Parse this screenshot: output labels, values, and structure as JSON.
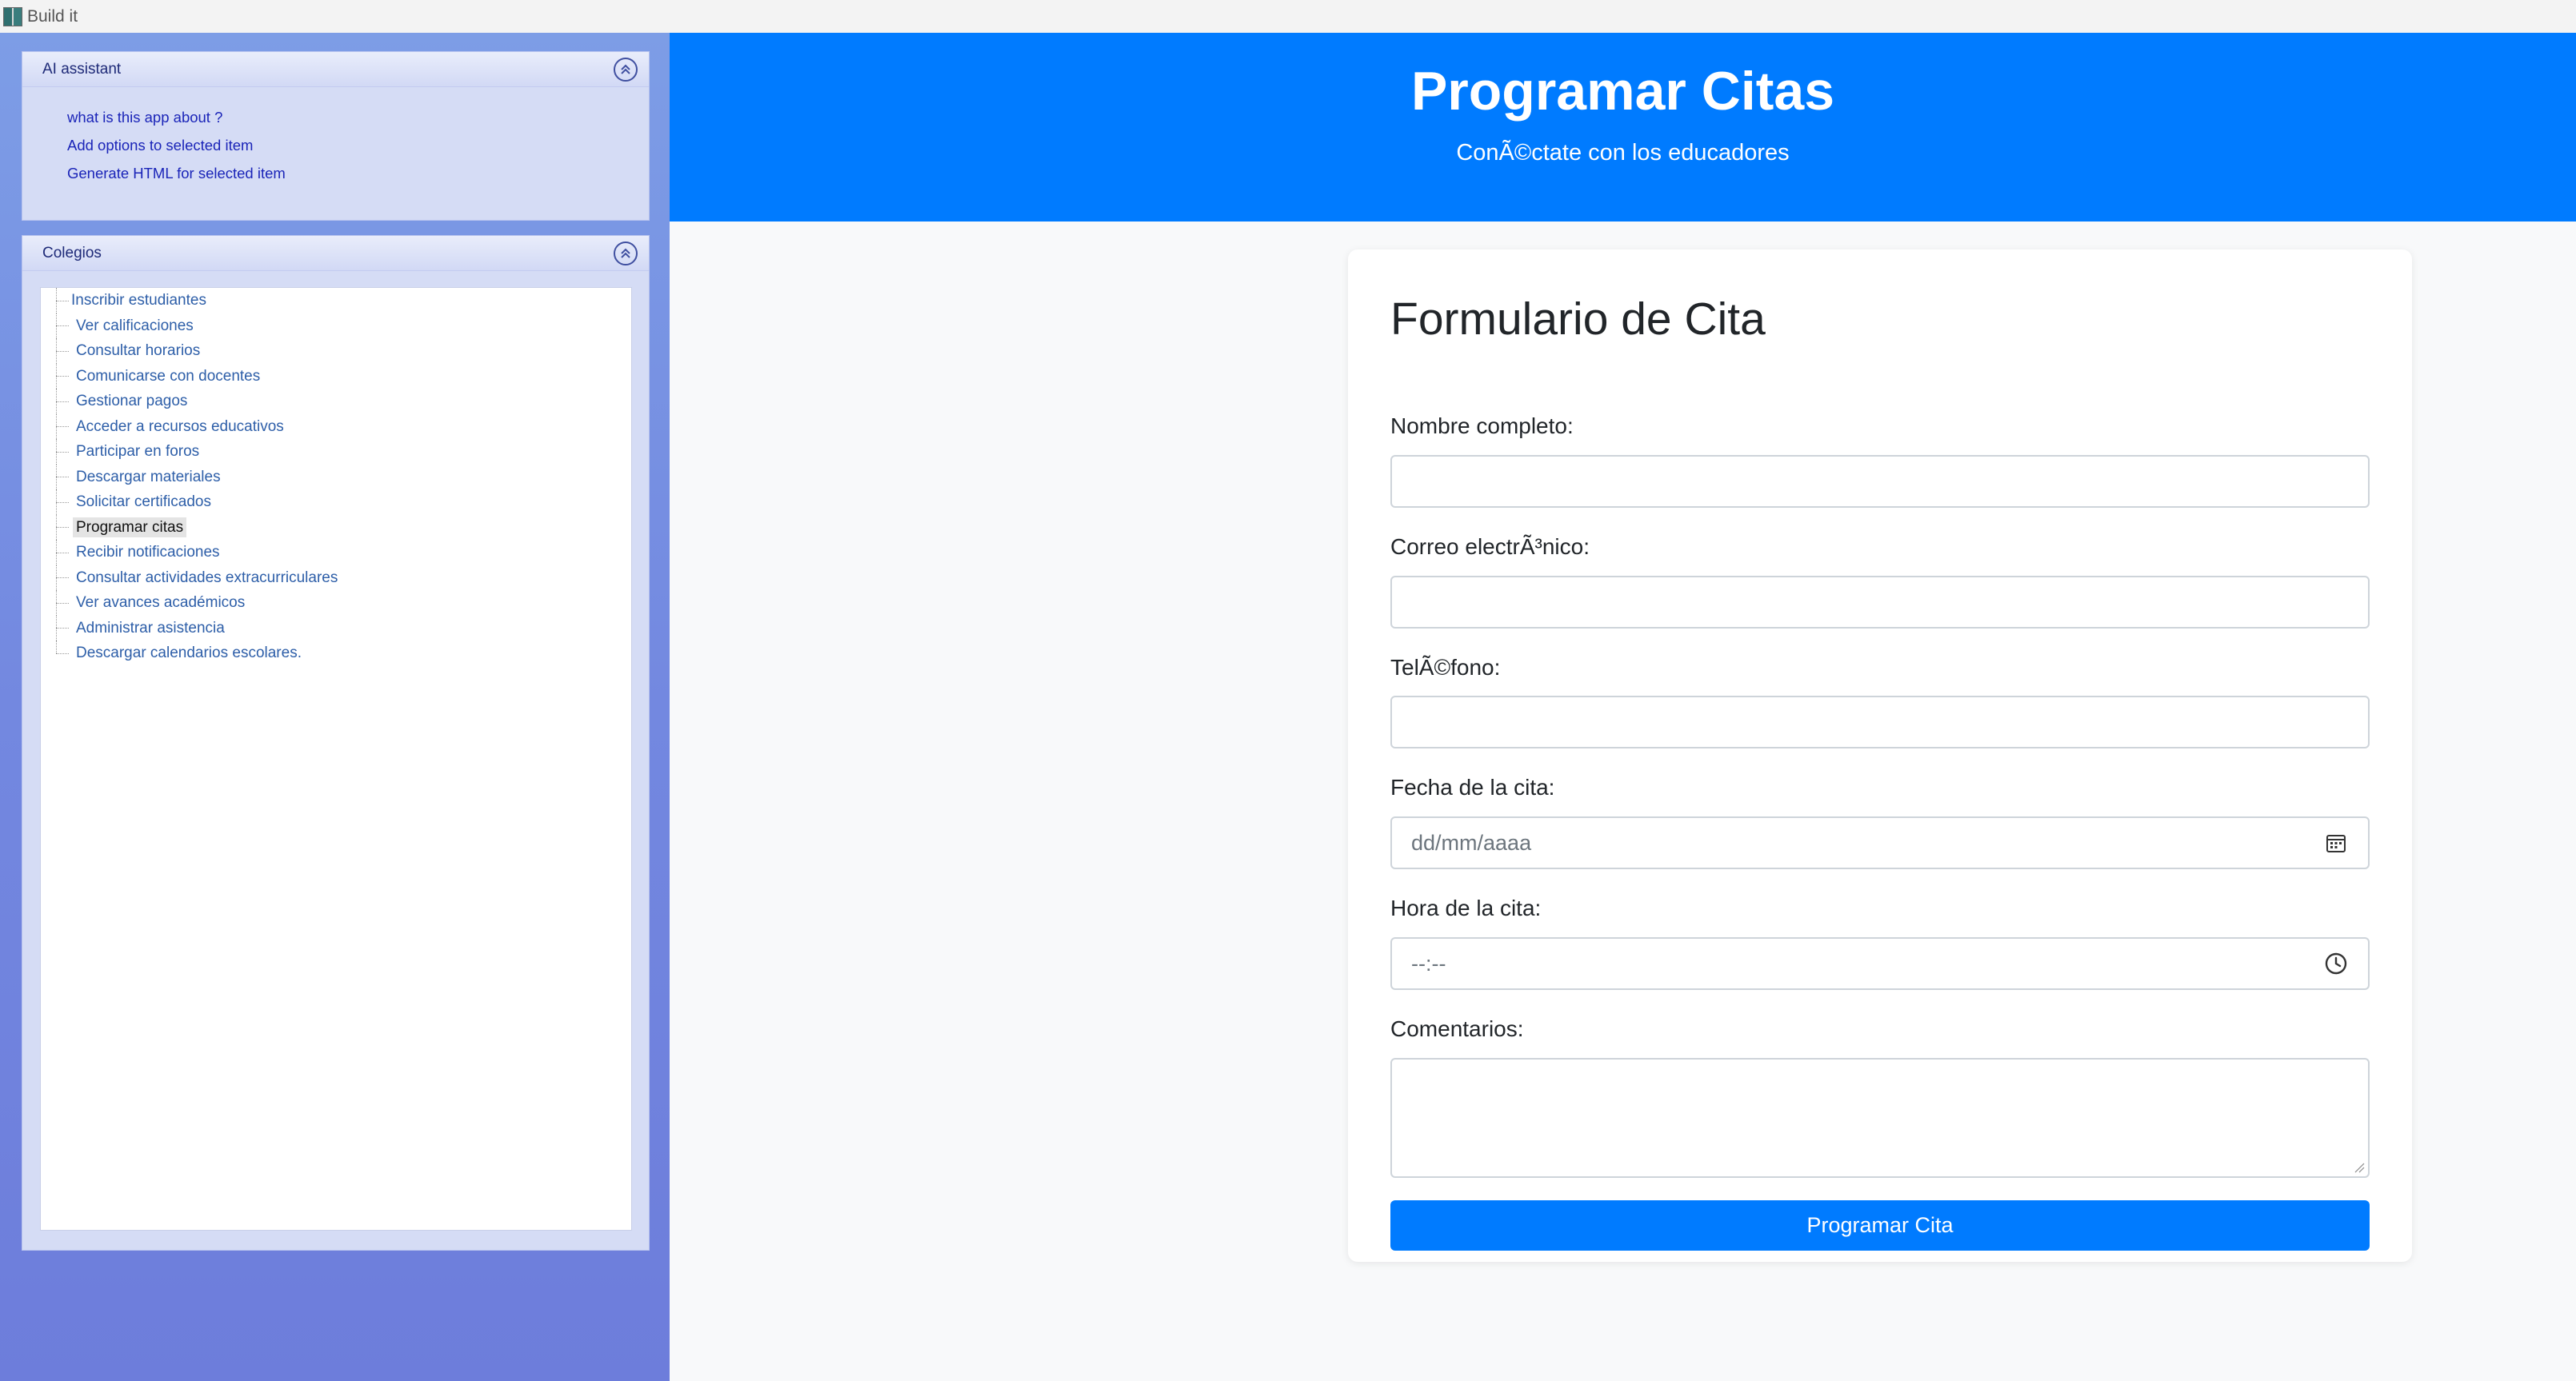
{
  "window": {
    "title": "Build it"
  },
  "sidebar": {
    "ai_assistant": {
      "title": "AI assistant",
      "items": [
        "what is this app about ?",
        "Add options to selected item",
        "Generate HTML for selected item"
      ]
    },
    "colegios": {
      "title": "Colegios",
      "items": [
        {
          "label": "Inscribir estudiantes",
          "selected": false
        },
        {
          "label": "Ver calificaciones",
          "selected": false
        },
        {
          "label": "Consultar horarios",
          "selected": false
        },
        {
          "label": "Comunicarse con docentes",
          "selected": false
        },
        {
          "label": "Gestionar pagos",
          "selected": false
        },
        {
          "label": "Acceder a recursos educativos",
          "selected": false
        },
        {
          "label": "Participar en foros",
          "selected": false
        },
        {
          "label": "Descargar materiales",
          "selected": false
        },
        {
          "label": "Solicitar certificados",
          "selected": false
        },
        {
          "label": "Programar citas",
          "selected": true
        },
        {
          "label": "Recibir notificaciones",
          "selected": false
        },
        {
          "label": "Consultar actividades extracurriculares",
          "selected": false
        },
        {
          "label": "Ver avances académicos",
          "selected": false
        },
        {
          "label": "Administrar asistencia",
          "selected": false
        },
        {
          "label": "Descargar calendarios escolares.",
          "selected": false
        }
      ]
    }
  },
  "header": {
    "title": "Programar Citas",
    "subtitle": "ConÃ©ctate con los educadores"
  },
  "form": {
    "title": "Formulario de Cita",
    "fields": {
      "name": {
        "label": "Nombre completo:",
        "value": ""
      },
      "email": {
        "label": "Correo electrÃ³nico:",
        "value": ""
      },
      "phone": {
        "label": "TelÃ©fono:",
        "value": ""
      },
      "date": {
        "label": "Fecha de la cita:",
        "placeholder": "dd/mm/aaaa"
      },
      "time": {
        "label": "Hora de la cita:",
        "placeholder": "--:--"
      },
      "comments": {
        "label": "Comentarios:",
        "value": ""
      }
    },
    "submit_label": "Programar Cita"
  },
  "colors": {
    "primary": "#007bff",
    "sidebar_top": "#7d9de6",
    "sidebar_bottom": "#6d7ddb"
  },
  "icons": [
    "collapse-icon",
    "calendar-icon",
    "clock-icon"
  ]
}
